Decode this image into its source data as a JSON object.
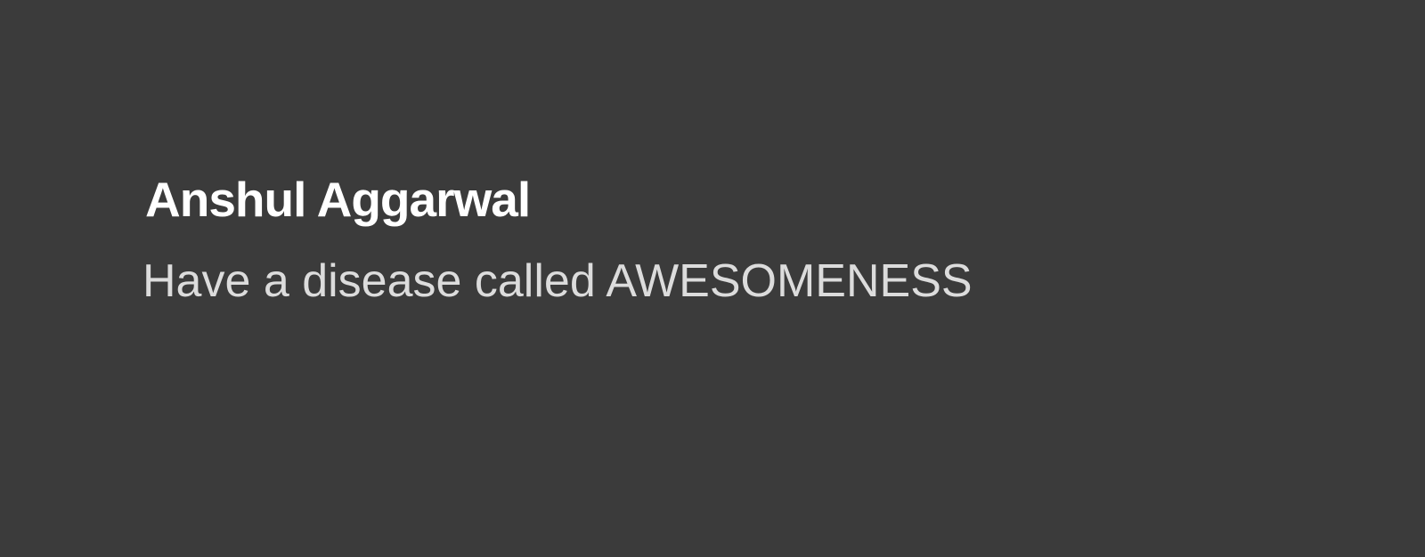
{
  "slide": {
    "title": "Anshul Aggarwal",
    "subtitle": "Have a disease called AWESOMENESS",
    "colors": {
      "background": "#3b3b3b",
      "title": "#ffffff",
      "subtitle": "#dcdcdc"
    }
  }
}
